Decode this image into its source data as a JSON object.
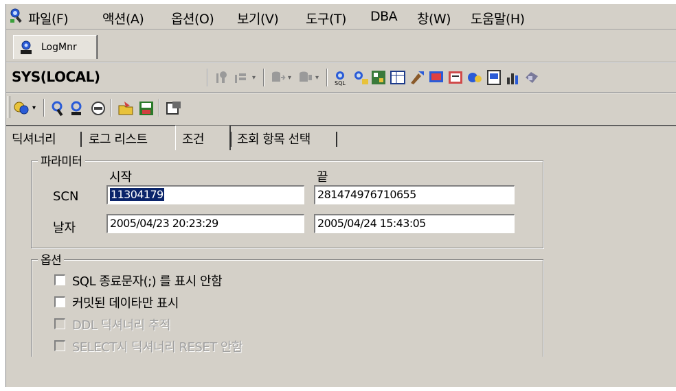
{
  "menu": {
    "items": [
      "파일(F)",
      "액션(A)",
      "옵션(O)",
      "보기(V)",
      "도구(T)",
      "DBA",
      "창(W)",
      "도움말(H)"
    ]
  },
  "mdi": {
    "tab_label": "LogMnr"
  },
  "connection": {
    "label": "SYS(LOCAL)"
  },
  "tabs": [
    {
      "label": "딕셔너리"
    },
    {
      "label": "로그 리스트"
    },
    {
      "label": "조건",
      "active": true
    },
    {
      "label": "조회 항목 선택"
    }
  ],
  "params": {
    "group_title": "파라미터",
    "start_header": "시작",
    "end_header": "끝",
    "scn_label": "SCN",
    "date_label": "날자",
    "scn_start": "11304179",
    "scn_end": "281474976710655",
    "date_start": "2005/04/23 20:23:29",
    "date_end": "2005/04/24 15:43:05"
  },
  "options": {
    "group_title": "옵션",
    "items": [
      {
        "label": "SQL 종료문자(;) 를 표시 안함",
        "checked": false,
        "enabled": true
      },
      {
        "label": "커밋된 데이타만 표시",
        "checked": false,
        "enabled": true
      },
      {
        "label": "DDL 딕셔너리 추적",
        "checked": false,
        "enabled": false
      },
      {
        "label": "SELECT시 딕셔너리 RESET 안함",
        "checked": false,
        "enabled": false
      }
    ]
  },
  "icons": {
    "app": "logmnr-app-icon",
    "toolbar": [
      "run-icon",
      "refresh-icon",
      "db-in-icon",
      "db-out-icon",
      "sql-icon",
      "explain-icon",
      "schema-icon",
      "table-icon",
      "tools-icon",
      "monitor-icon",
      "report-icon",
      "session-icon",
      "export-icon",
      "stats-icon",
      "settings-icon"
    ],
    "tools": [
      "connect-icon",
      "search-icon",
      "search-user-icon",
      "stop-icon",
      "open-folder-icon",
      "save-icon",
      "properties-icon"
    ]
  },
  "colors": {
    "selection": "#0a246a",
    "window_bg": "#d4d0c8"
  }
}
